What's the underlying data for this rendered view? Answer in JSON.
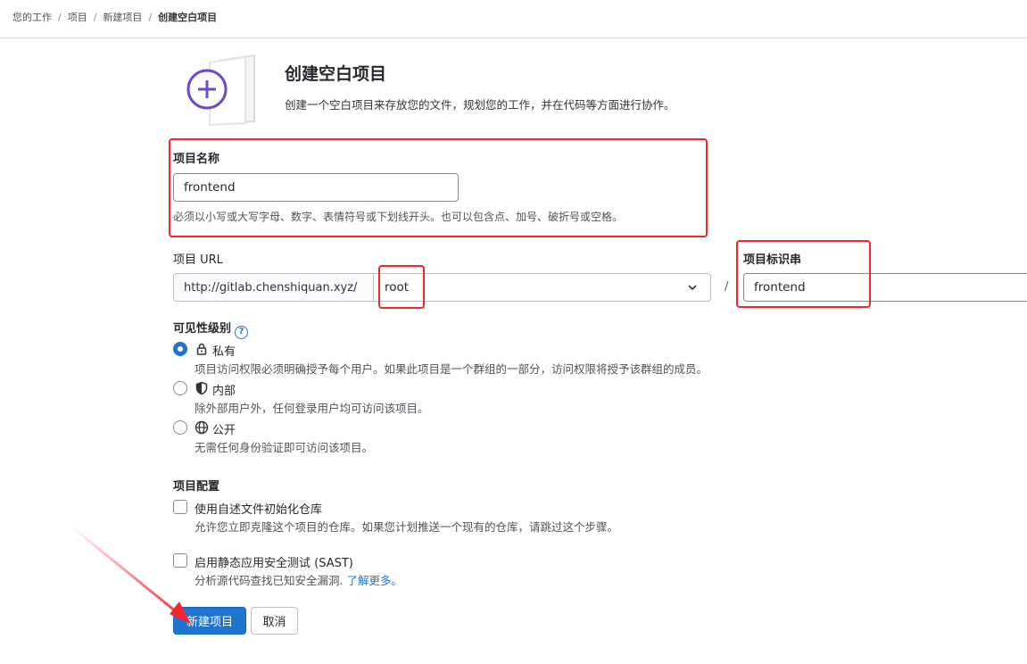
{
  "breadcrumb": {
    "items": [
      "您的工作",
      "项目",
      "新建项目"
    ],
    "current": "创建空白项目",
    "separator": "/"
  },
  "header": {
    "title": "创建空白项目",
    "description": "创建一个空白项目来存放您的文件，规划您的工作，并在代码等方面进行协作。"
  },
  "form": {
    "project_name": {
      "label": "项目名称",
      "value": "frontend",
      "help": "必须以小写或大写字母、数字、表情符号或下划线开头。也可以包含点、加号、破折号或空格。"
    },
    "project_url": {
      "label": "项目 URL",
      "prefix": "http://gitlab.chenshiquan.xyz/",
      "namespace": "root",
      "separator": "/"
    },
    "project_slug": {
      "label": "项目标识串",
      "value": "frontend"
    },
    "visibility": {
      "label": "可见性级别",
      "help_icon": "?",
      "options": [
        {
          "label": "私有",
          "icon": "lock-icon",
          "checked": true,
          "description": "项目访问权限必须明确授予每个用户。如果此项目是一个群组的一部分，访问权限将授予该群组的成员。"
        },
        {
          "label": "内部",
          "icon": "shield-icon",
          "checked": false,
          "description": "除外部用户外，任何登录用户均可访问该项目。"
        },
        {
          "label": "公开",
          "icon": "globe-icon",
          "checked": false,
          "description": "无需任何身份验证即可访问该项目。"
        }
      ]
    },
    "config": {
      "label": "项目配置",
      "readme": {
        "label": "使用自述文件初始化仓库",
        "description": "允许您立即克隆这个项目的仓库。如果您计划推送一个现有的仓库，请跳过这个步骤。",
        "checked": false
      },
      "sast": {
        "label": "启用静态应用安全测试 (SAST)",
        "description": "分析源代码查找已知安全漏洞.",
        "link": "了解更多。",
        "checked": false
      }
    }
  },
  "actions": {
    "create": "新建项目",
    "cancel": "取消"
  },
  "colors": {
    "primary": "#1f75cb",
    "annotation": "#f5252d",
    "illustration": "#6e49cb"
  }
}
